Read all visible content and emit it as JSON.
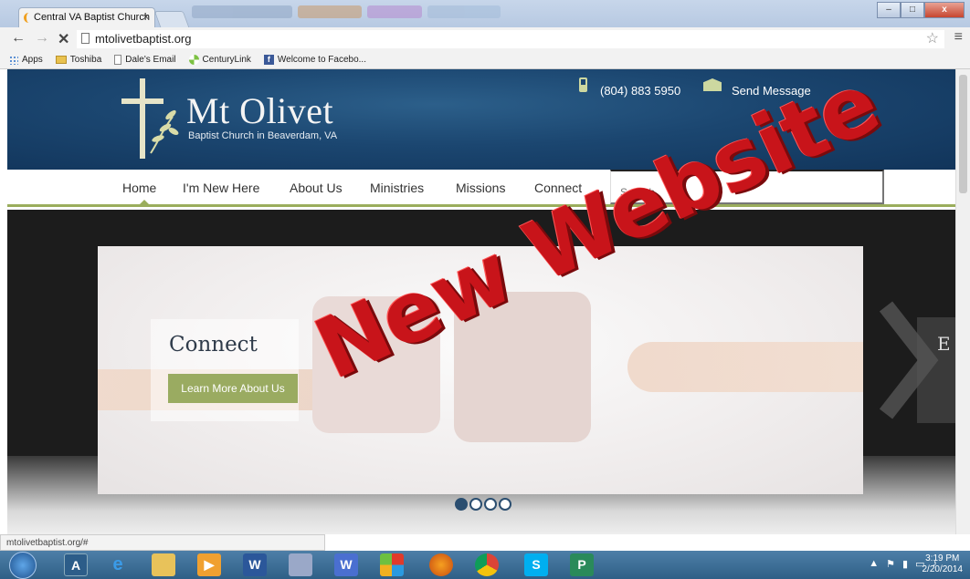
{
  "browser": {
    "tab_title": "Central VA Baptist Church",
    "tab_close": "×",
    "url": "mtolivetbaptist.org",
    "back": "←",
    "forward": "→",
    "stop": "✕",
    "star": "☆",
    "menu": "≡",
    "window_minimize": "–",
    "window_maximize": "□",
    "window_close": "x"
  },
  "bookmarks": [
    {
      "label": "Apps",
      "icon": "apps-icon"
    },
    {
      "label": "Toshiba",
      "icon": "folder-icon"
    },
    {
      "label": "Dale's Email",
      "icon": "page-icon"
    },
    {
      "label": "CenturyLink",
      "icon": "centurylink-icon"
    },
    {
      "label": "Welcome to Facebo...",
      "icon": "facebook-icon"
    }
  ],
  "site": {
    "logo_title": "Mt Olivet",
    "logo_subtitle": "Baptist Church in Beaverdam, VA",
    "phone": "(804) 883 5950",
    "send_message": "Send Message",
    "nav": [
      "Home",
      "I'm New Here",
      "About Us",
      "Ministries",
      "Missions",
      "Connect"
    ],
    "search_placeholder": "Search",
    "slide_heading": "Connect",
    "slide_button": "Learn More About Us",
    "next_peek": "E",
    "active_slide": 1,
    "slide_count": 4
  },
  "watermark": "New Website",
  "status_url": "mtolivetbaptist.org/#",
  "taskbar": {
    "icons": [
      "windows-start-icon",
      "app-icon",
      "internet-explorer-icon",
      "file-explorer-icon",
      "media-player-icon",
      "word-icon",
      "paint-icon",
      "bookmark-app-icon",
      "windows-store-icon",
      "firefox-icon",
      "chrome-icon",
      "skype-icon",
      "publisher-icon"
    ],
    "time": "3:19 PM",
    "date": "2/20/2014"
  },
  "colors": {
    "header_blue": "#1b4670",
    "accent_green": "#9aab61",
    "watermark_red": "#c8141a"
  }
}
